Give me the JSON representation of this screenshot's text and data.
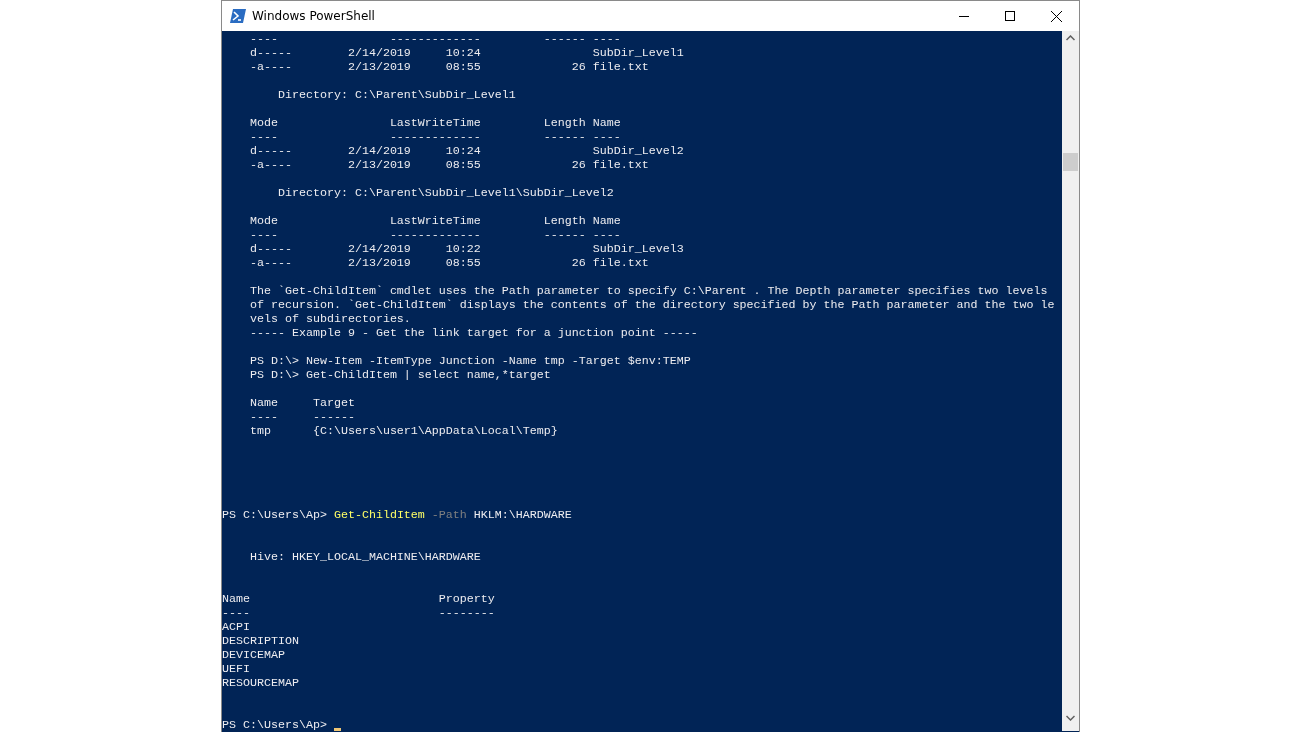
{
  "window": {
    "title": "Windows PowerShell"
  },
  "console": {
    "lines": [
      {
        "kind": "text",
        "text": "    ----                -------------         ------ ----"
      },
      {
        "kind": "text",
        "text": "    d-----        2/14/2019     10:24                SubDir_Level1"
      },
      {
        "kind": "text",
        "text": "    -a----        2/13/2019     08:55             26 file.txt"
      },
      {
        "kind": "blank"
      },
      {
        "kind": "text",
        "text": "        Directory: C:\\Parent\\SubDir_Level1"
      },
      {
        "kind": "blank"
      },
      {
        "kind": "text",
        "text": "    Mode                LastWriteTime         Length Name"
      },
      {
        "kind": "text",
        "text": "    ----                -------------         ------ ----"
      },
      {
        "kind": "text",
        "text": "    d-----        2/14/2019     10:24                SubDir_Level2"
      },
      {
        "kind": "text",
        "text": "    -a----        2/13/2019     08:55             26 file.txt"
      },
      {
        "kind": "blank"
      },
      {
        "kind": "text",
        "text": "        Directory: C:\\Parent\\SubDir_Level1\\SubDir_Level2"
      },
      {
        "kind": "blank"
      },
      {
        "kind": "text",
        "text": "    Mode                LastWriteTime         Length Name"
      },
      {
        "kind": "text",
        "text": "    ----                -------------         ------ ----"
      },
      {
        "kind": "text",
        "text": "    d-----        2/14/2019     10:22                SubDir_Level3"
      },
      {
        "kind": "text",
        "text": "    -a----        2/13/2019     08:55             26 file.txt"
      },
      {
        "kind": "blank"
      },
      {
        "kind": "text",
        "text": "    The `Get-ChildItem` cmdlet uses the Path parameter to specify C:\\Parent . The Depth parameter specifies two levels"
      },
      {
        "kind": "text",
        "text": "    of recursion. `Get-ChildItem` displays the contents of the directory specified by the Path parameter and the two le"
      },
      {
        "kind": "text",
        "text": "    vels of subdirectories."
      },
      {
        "kind": "text",
        "text": "    ----- Example 9 - Get the link target for a junction point -----"
      },
      {
        "kind": "blank"
      },
      {
        "kind": "text",
        "text": "    PS D:\\> New-Item -ItemType Junction -Name tmp -Target $env:TEMP"
      },
      {
        "kind": "text",
        "text": "    PS D:\\> Get-ChildItem | select name,*target"
      },
      {
        "kind": "blank"
      },
      {
        "kind": "text",
        "text": "    Name     Target"
      },
      {
        "kind": "text",
        "text": "    ----     ------"
      },
      {
        "kind": "text",
        "text": "    tmp      {C:\\Users\\user1\\AppData\\Local\\Temp}"
      },
      {
        "kind": "blank"
      },
      {
        "kind": "blank"
      },
      {
        "kind": "blank"
      },
      {
        "kind": "blank"
      },
      {
        "kind": "blank"
      },
      {
        "kind": "command",
        "parts": [
          {
            "kind": "prompt",
            "text": "PS C:\\Users\\Ap> "
          },
          {
            "kind": "cmdlet",
            "text": "Get-ChildItem "
          },
          {
            "kind": "parameter",
            "text": "-Path"
          },
          {
            "kind": "plain",
            "text": " HKLM:\\HARDWARE"
          }
        ]
      },
      {
        "kind": "blank"
      },
      {
        "kind": "blank"
      },
      {
        "kind": "text",
        "text": "    Hive: HKEY_LOCAL_MACHINE\\HARDWARE"
      },
      {
        "kind": "blank"
      },
      {
        "kind": "blank"
      },
      {
        "kind": "text",
        "text": "Name                           Property"
      },
      {
        "kind": "text",
        "text": "----                           --------"
      },
      {
        "kind": "text",
        "text": "ACPI"
      },
      {
        "kind": "text",
        "text": "DESCRIPTION"
      },
      {
        "kind": "text",
        "text": "DEVICEMAP"
      },
      {
        "kind": "text",
        "text": "UEFI"
      },
      {
        "kind": "text",
        "text": "RESOURCEMAP"
      },
      {
        "kind": "blank"
      },
      {
        "kind": "blank"
      },
      {
        "kind": "input",
        "prompt": "PS C:\\Users\\Ap> "
      }
    ]
  }
}
